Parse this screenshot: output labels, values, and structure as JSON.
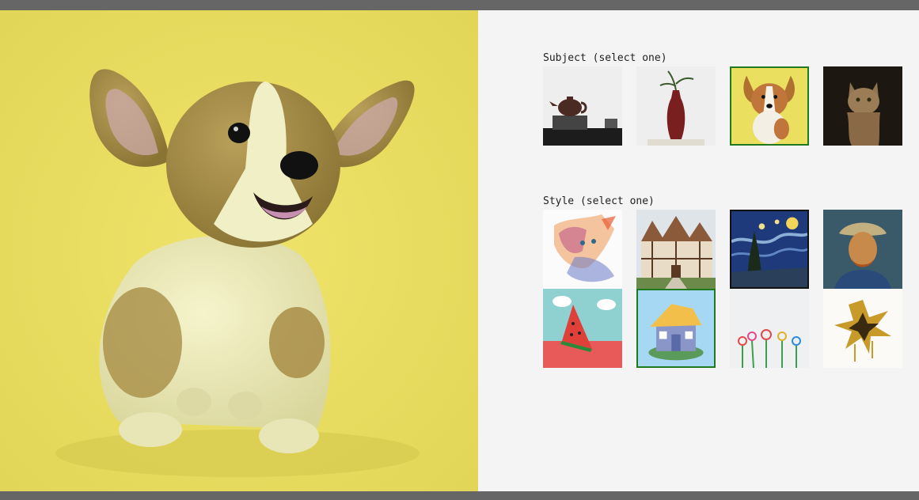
{
  "subject": {
    "label": "Subject (select one)",
    "options": [
      {
        "name": "teapot",
        "selected": false
      },
      {
        "name": "vase",
        "selected": false
      },
      {
        "name": "corgi",
        "selected": true
      },
      {
        "name": "cat",
        "selected": false
      }
    ]
  },
  "style": {
    "label": "Style (select one)",
    "options": [
      {
        "name": "watercolor-cat",
        "selected": false
      },
      {
        "name": "tudor-house",
        "selected": false
      },
      {
        "name": "starry-night",
        "selected": false,
        "hovered": true
      },
      {
        "name": "van-gogh-portrait",
        "selected": false
      },
      {
        "name": "watermelon-3d",
        "selected": false
      },
      {
        "name": "toy-house",
        "selected": true
      },
      {
        "name": "child-flowers",
        "selected": false
      },
      {
        "name": "gold-flower",
        "selected": false
      }
    ]
  },
  "colors": {
    "selected_border": "#1f7a1f",
    "preview_background": "#e8de5e",
    "chrome_bar": "#666666"
  }
}
